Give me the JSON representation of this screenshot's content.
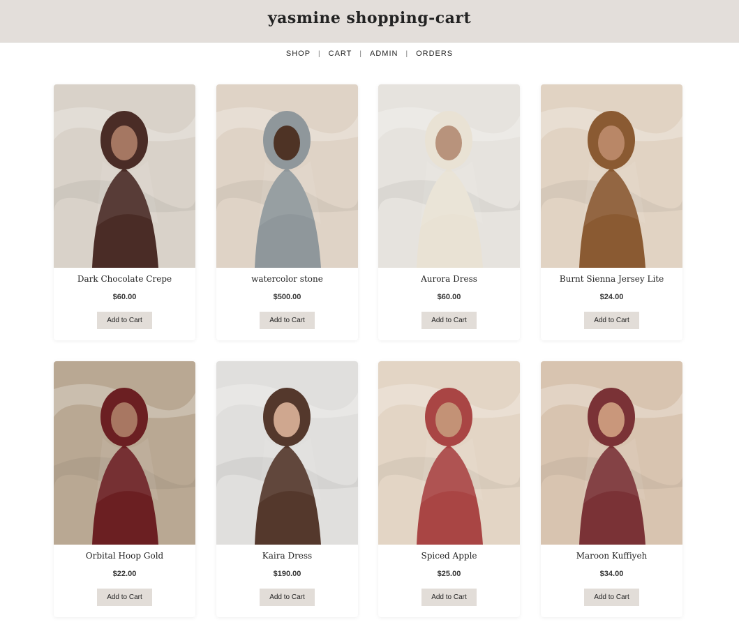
{
  "header": {
    "title": "yasmine shopping-cart"
  },
  "nav": {
    "items": [
      "SHOP",
      "CART",
      "ADMIN",
      "ORDERS"
    ],
    "separator": "|"
  },
  "products": [
    {
      "name": "Dark Chocolate Crepe",
      "price": "$60.00",
      "button": "Add to Cart",
      "bg": "#d9d2c9",
      "accent": "#4a2c26",
      "skin": "#a57762"
    },
    {
      "name": "watercolor stone",
      "price": "$500.00",
      "button": "Add to Cart",
      "bg": "#dfd3c6",
      "accent": "#8f979b",
      "skin": "#4e3325"
    },
    {
      "name": "Aurora Dress",
      "price": "$60.00",
      "button": "Add to Cart",
      "bg": "#e6e3de",
      "accent": "#e9e2d4",
      "skin": "#b8937c"
    },
    {
      "name": "Burnt Sienna Jersey Lite",
      "price": "$24.00",
      "button": "Add to Cart",
      "bg": "#e1d3c3",
      "accent": "#8a5a32",
      "skin": "#b98767"
    },
    {
      "name": "Orbital Hoop Gold",
      "price": "$22.00",
      "button": "Add to Cart",
      "bg": "#b9a893",
      "accent": "#6b1f22",
      "skin": "#a87762"
    },
    {
      "name": "Kaira Dress",
      "price": "$190.00",
      "button": "Add to Cart",
      "bg": "#e0dfdd",
      "accent": "#54382c",
      "skin": "#cfa78f"
    },
    {
      "name": "Spiced Apple",
      "price": "$25.00",
      "button": "Add to Cart",
      "bg": "#e3d5c5",
      "accent": "#a94544",
      "skin": "#c39276"
    },
    {
      "name": "Maroon Kuffiyeh",
      "price": "$34.00",
      "button": "Add to Cart",
      "bg": "#d8c4b0",
      "accent": "#7a3236",
      "skin": "#c9977b"
    }
  ]
}
